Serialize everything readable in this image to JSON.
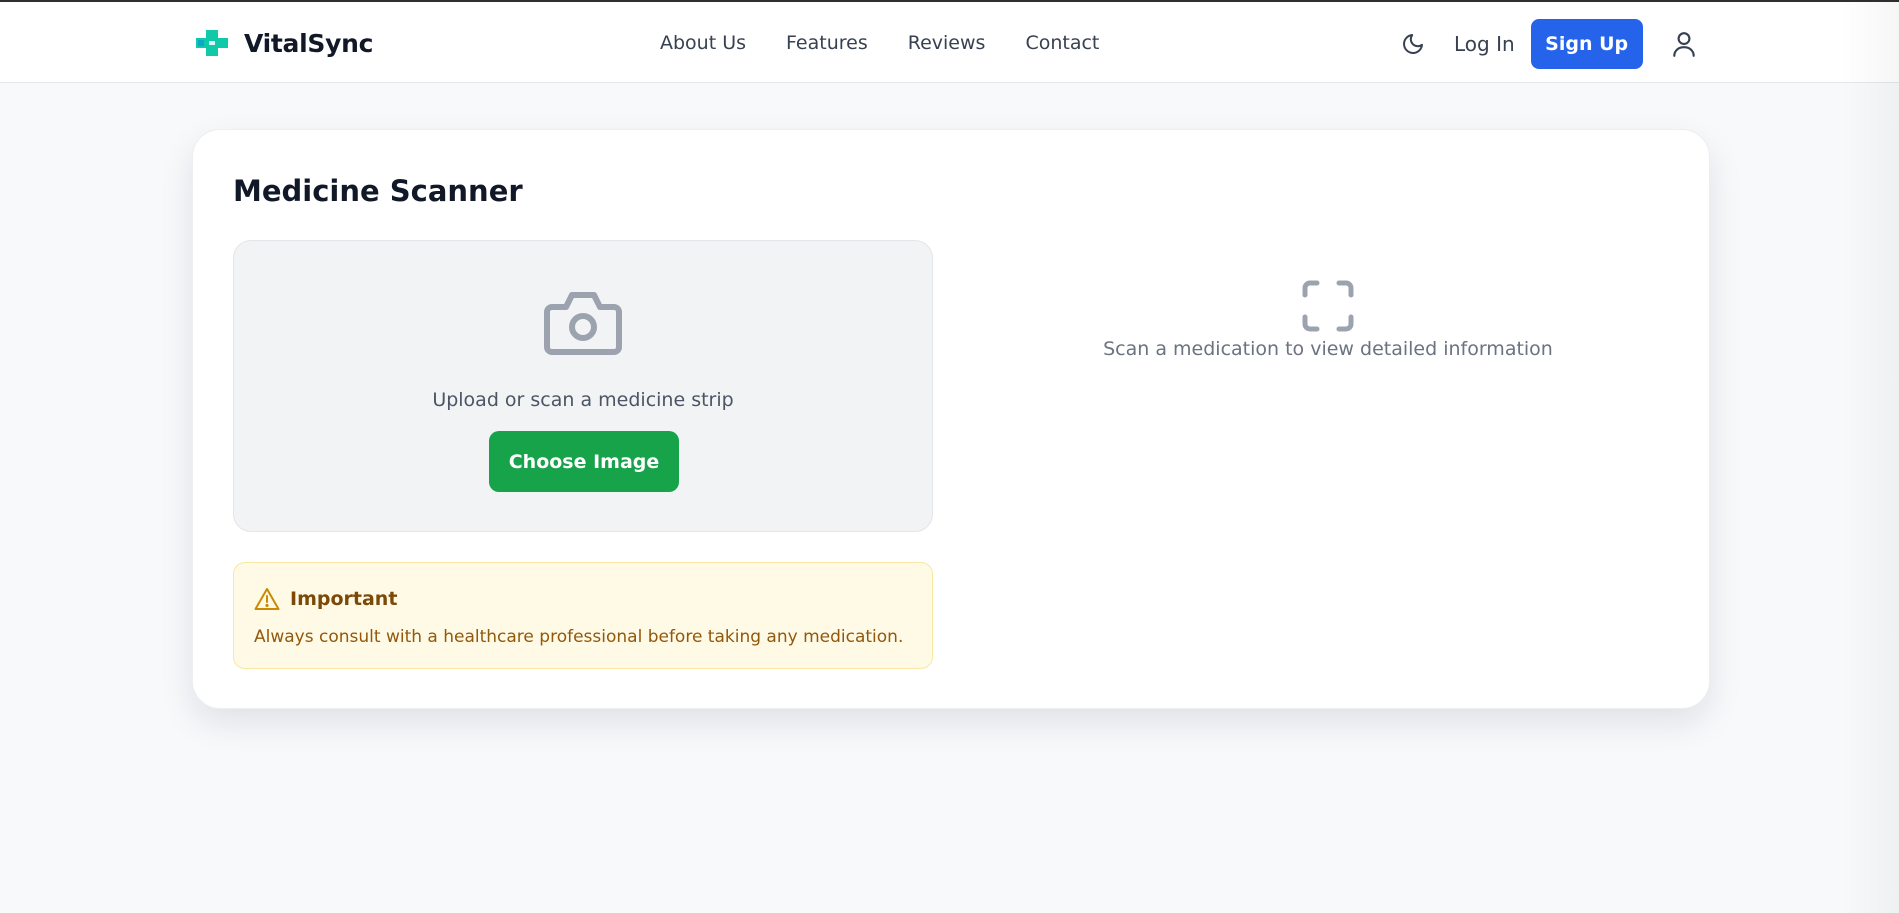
{
  "brand": {
    "name": "VitalSync",
    "logo_icon": "medical-cross-icon",
    "logo_color": "#10c9a8"
  },
  "nav": {
    "links": [
      "About Us",
      "Features",
      "Reviews",
      "Contact"
    ],
    "theme_toggle_icon": "moon-icon",
    "login_label": "Log In",
    "signup_label": "Sign Up",
    "profile_icon": "user-icon"
  },
  "scanner": {
    "title": "Medicine Scanner",
    "upload": {
      "icon": "camera-icon",
      "text": "Upload or scan a medicine strip",
      "button_label": "Choose Image"
    },
    "warning": {
      "icon": "alert-triangle-icon",
      "title": "Important",
      "text": "Always consult with a healthcare professional before taking any medication."
    },
    "result": {
      "icon": "scan-frame-icon",
      "placeholder": "Scan a medication to view detailed information"
    }
  },
  "colors": {
    "primary": "#2563eb",
    "success": "#16a34a",
    "warning_bg": "#fefae6",
    "warning_text": "#92580c"
  }
}
